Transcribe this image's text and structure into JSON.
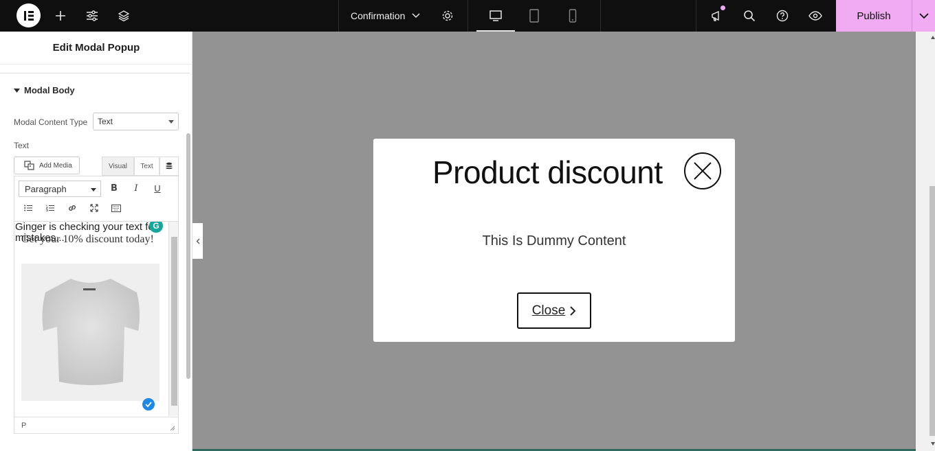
{
  "topbar": {
    "document_title": "Confirmation",
    "publish_label": "Publish"
  },
  "panel": {
    "title": "Edit Modal Popup",
    "section": "Modal Body",
    "content_type_label": "Modal Content Type",
    "content_type_value": "Text",
    "text_label": "Text",
    "add_media_label": "Add Media",
    "editor_tabs": [
      "Visual",
      "Text"
    ],
    "format_select": "Paragraph",
    "ginger_line1": "Ginger is checking your text for",
    "ginger_line2": "mistakes...",
    "editor_text": "Get your 10% discount today!",
    "path_indicator": "P"
  },
  "modal": {
    "title": "Product discount",
    "body": "This Is Dummy Content",
    "button_label": "Close"
  },
  "colors": {
    "topbar": "#0f0f10",
    "publish": "#f0abf3",
    "canvas": "#939393"
  }
}
